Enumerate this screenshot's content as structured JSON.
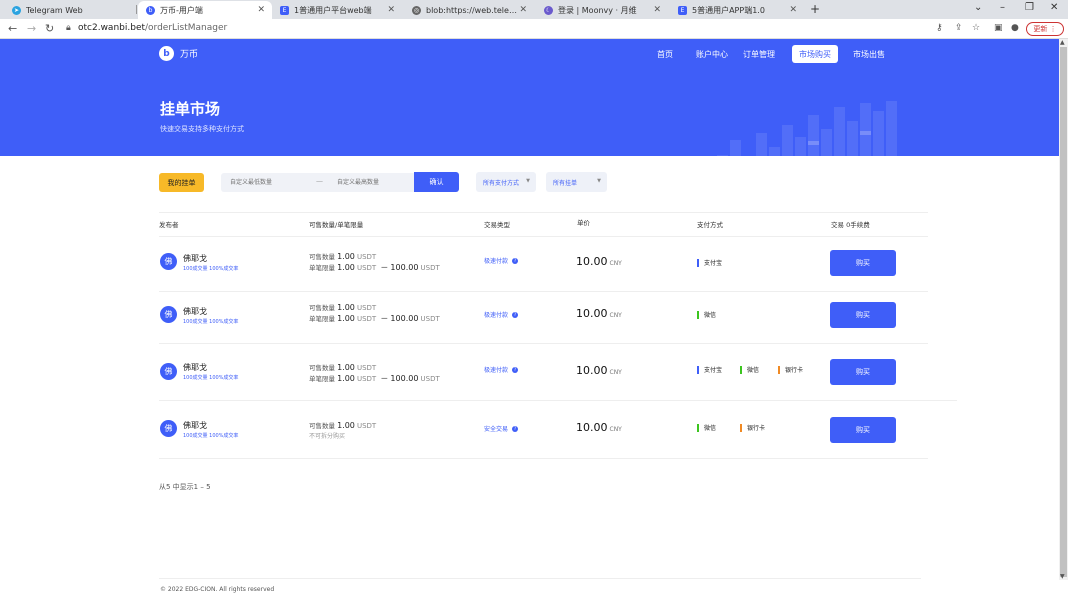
{
  "browser": {
    "tabs": [
      {
        "title": "Telegram Web",
        "icon": "telegram-icon",
        "active": false
      },
      {
        "title": "万币-用户端",
        "icon": "wanbi-icon",
        "active": true
      },
      {
        "title": "1普通用户平台web端",
        "icon": "doc-icon",
        "active": false
      },
      {
        "title": "blob:https://web.telegram.org/...",
        "icon": "globe-icon",
        "active": false
      },
      {
        "title": "登录 | Moonvy · 月维",
        "icon": "moonvy-icon",
        "active": false
      },
      {
        "title": "5普通用户APP端1.0",
        "icon": "doc-icon",
        "active": false
      }
    ],
    "url_host": "otc2.wanbi.bet",
    "url_path": "/orderListManager",
    "update_label": "更新"
  },
  "header": {
    "logo_text": "万币",
    "nav": [
      {
        "label": "首页",
        "active": false
      },
      {
        "label": "账户中心",
        "active": false
      },
      {
        "label": "订单管理",
        "active": false
      },
      {
        "label": "市场购买",
        "active": true
      },
      {
        "label": "市场出售",
        "active": false
      }
    ],
    "title": "挂单市场",
    "subtitle": "快速交易支持多种支付方式"
  },
  "filters": {
    "my_orders_label": "我的挂单",
    "min_placeholder": "自定义最低数量",
    "separator": "—",
    "max_placeholder": "自定义最高数量",
    "confirm_label": "确认",
    "payment_select": "所有支付方式",
    "order_select": "所有挂单"
  },
  "table": {
    "headers": {
      "publisher": "发布者",
      "quantity": "可售数量/单笔限量",
      "trade_type": "交易类型",
      "unit_price": "单价",
      "payment": "支付方式",
      "trade": "交易 0手续费"
    },
    "rows": [
      {
        "avatar": "佛",
        "name": "佛耶戈",
        "stat1": "100成交量",
        "stat2": "100%成交率",
        "avail_label": "可售数量",
        "avail": "1.00",
        "unit": "USDT",
        "limit_label": "单笔限量",
        "limit_min": "1.00",
        "limit_sep": "－",
        "limit_max": "100.00",
        "limit_note": "",
        "type": "极速付款",
        "price": "10.00",
        "currency": "CNY",
        "payments": [
          {
            "label": "支付宝",
            "color": "#3f5ef8"
          }
        ],
        "buy_label": "购买"
      },
      {
        "avatar": "佛",
        "name": "佛耶戈",
        "stat1": "100成交量",
        "stat2": "100%成交率",
        "avail_label": "可售数量",
        "avail": "1.00",
        "unit": "USDT",
        "limit_label": "单笔限量",
        "limit_min": "1.00",
        "limit_sep": "－",
        "limit_max": "100.00",
        "limit_note": "",
        "type": "极速付款",
        "price": "10.00",
        "currency": "CNY",
        "payments": [
          {
            "label": "微信",
            "color": "#3cc51f"
          }
        ],
        "buy_label": "购买"
      },
      {
        "avatar": "佛",
        "name": "佛耶戈",
        "stat1": "100成交量",
        "stat2": "100%成交率",
        "avail_label": "可售数量",
        "avail": "1.00",
        "unit": "USDT",
        "limit_label": "单笔限量",
        "limit_min": "1.00",
        "limit_sep": "－",
        "limit_max": "100.00",
        "limit_note": "",
        "type": "极速付款",
        "price": "10.00",
        "currency": "CNY",
        "payments": [
          {
            "label": "支付宝",
            "color": "#3f5ef8"
          },
          {
            "label": "微信",
            "color": "#3cc51f"
          },
          {
            "label": "银行卡",
            "color": "#f08a24"
          }
        ],
        "buy_label": "购买"
      },
      {
        "avatar": "佛",
        "name": "佛耶戈",
        "stat1": "100成交量",
        "stat2": "100%成交率",
        "avail_label": "可售数量",
        "avail": "1.00",
        "unit": "USDT",
        "limit_label": "",
        "limit_min": "",
        "limit_sep": "",
        "limit_max": "",
        "limit_note": "不可拆分购买",
        "type": "安全交易",
        "price": "10.00",
        "currency": "CNY",
        "payments": [
          {
            "label": "微信",
            "color": "#3cc51f"
          },
          {
            "label": "银行卡",
            "color": "#f08a24"
          }
        ],
        "buy_label": "购买"
      }
    ]
  },
  "pagination": "从5 中显示1 – 5",
  "footer": "© 2022 EDG-CION. All rights reserved"
}
